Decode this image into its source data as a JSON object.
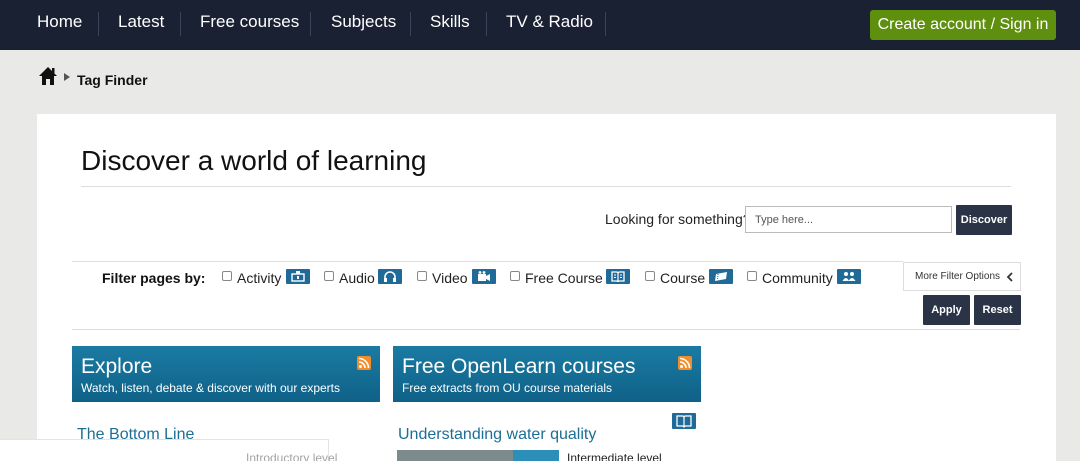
{
  "nav": {
    "items": [
      "Home",
      "Latest",
      "Free courses",
      "Subjects",
      "Skills",
      "TV & Radio"
    ],
    "signin_label": "Create account / Sign in"
  },
  "breadcrumb": {
    "current": "Tag Finder",
    "home_icon": "home-icon"
  },
  "main": {
    "heading": "Discover a world of learning",
    "search": {
      "label": "Looking for something?",
      "placeholder": "Type here...",
      "button": "Discover"
    }
  },
  "filter": {
    "label": "Filter pages by:",
    "options": [
      {
        "label": "Activity",
        "icon": "activity-icon",
        "checked": false
      },
      {
        "label": "Audio",
        "icon": "headphones-icon",
        "checked": false
      },
      {
        "label": "Video",
        "icon": "video-camera-icon",
        "checked": false
      },
      {
        "label": "Free Course",
        "icon": "open-book-icon",
        "checked": false
      },
      {
        "label": "Course",
        "icon": "ticket-icon",
        "checked": false
      },
      {
        "label": "Community",
        "icon": "people-icon",
        "checked": false
      }
    ],
    "more_label": "More Filter Options",
    "apply_label": "Apply",
    "reset_label": "Reset"
  },
  "panels": [
    {
      "title": "Explore",
      "subtitle": "Watch, listen, debate & discover with our experts",
      "result_title": "The Bottom Line",
      "result_level": "Introductory level"
    },
    {
      "title": "Free OpenLearn courses",
      "subtitle": "Free extracts from OU course materials",
      "result_title": "Understanding water quality",
      "result_level": "Intermediate level"
    }
  ],
  "colors": {
    "nav_bg": "#1a2133",
    "signin_green": "#5f8f0e",
    "banner_blue": "#1b7ba3",
    "link_blue": "#1c6e95",
    "rss_orange": "#f28d2b"
  }
}
